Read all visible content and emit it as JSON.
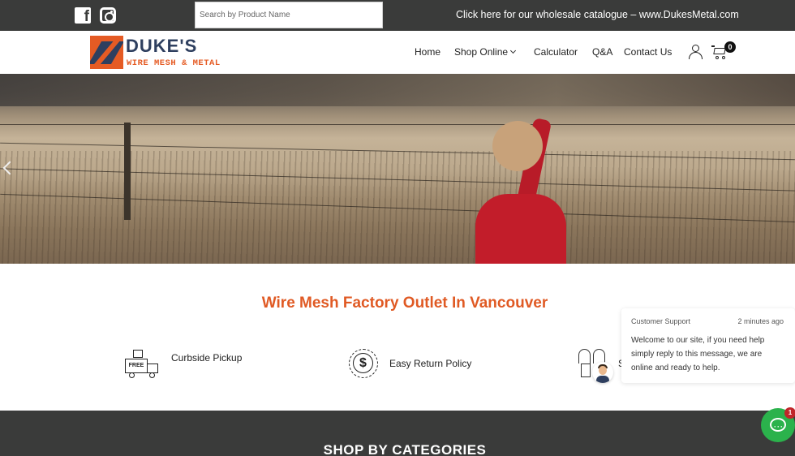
{
  "topbar": {
    "search_placeholder": "Search by Product Name",
    "wholesale_text": "Click here for our wholesale catalogue – www.DukesMetal.com",
    "social_icons": [
      "facebook-icon",
      "instagram-icon"
    ]
  },
  "header": {
    "logo_title": "DUKE'S",
    "logo_subtitle": "WIRE MESH & METAL",
    "nav": [
      {
        "label": "Home"
      },
      {
        "label": "Shop Online"
      },
      {
        "label": "Calculator"
      },
      {
        "label": "Q&A"
      },
      {
        "label": "Contact Us"
      }
    ],
    "cart_count": "0"
  },
  "hero": {
    "slider_control": "chevron-left-icon"
  },
  "features": {
    "title": "Wire Mesh Factory Outlet In Vancouver",
    "items": [
      {
        "icon": "free-delivery-truck-icon",
        "label": "Curbside Pickup"
      },
      {
        "icon": "dollar-return-icon",
        "label": "Easy Return Policy"
      },
      {
        "icon": "secure-lock-icon",
        "label": "S"
      }
    ]
  },
  "chat": {
    "sender": "Customer Support",
    "time": "2 minutes ago",
    "message": "Welcome to our site, if you need help simply reply to this message, we are online and ready to help.",
    "unread_count": "1"
  },
  "categories": {
    "title": "SHOP BY CATEGORIES"
  },
  "colors": {
    "accent": "#e05a24",
    "brand_navy": "#2e3f5f",
    "dark_bar": "#3a3b3a",
    "chat_green": "#2bb24c"
  }
}
